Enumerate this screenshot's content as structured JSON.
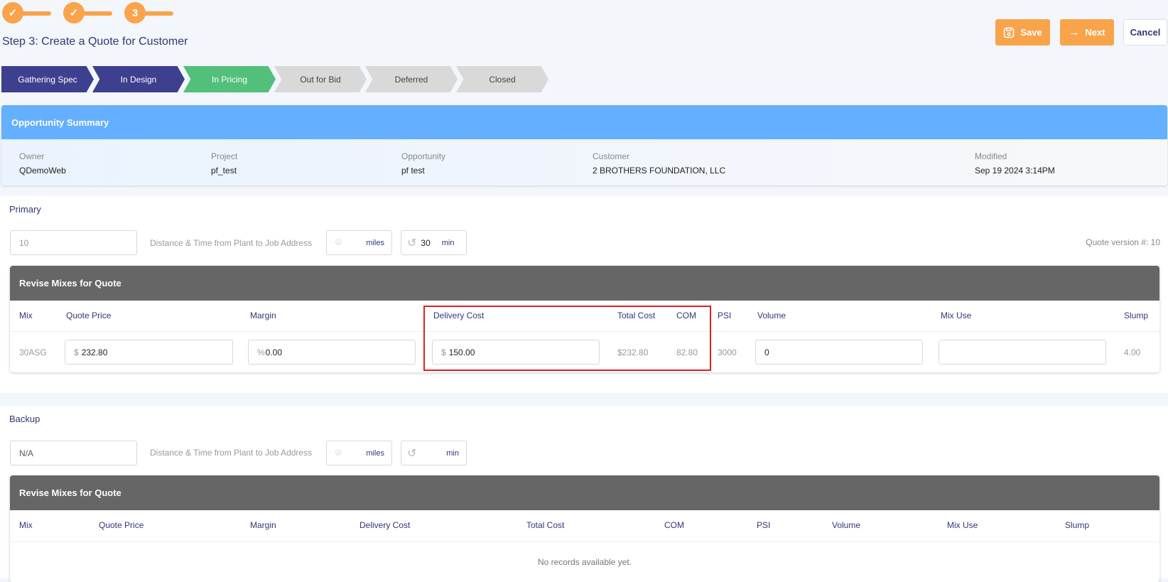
{
  "wizard": {
    "steps": [
      {
        "state": "done"
      },
      {
        "state": "done"
      },
      {
        "label": "3",
        "state": "current"
      }
    ],
    "title": "Step 3: Create a Quote for Customer"
  },
  "actions": {
    "save": "Save",
    "next": "Next",
    "cancel": "Cancel"
  },
  "stages": [
    {
      "label": "Gathering Spec",
      "state": "done"
    },
    {
      "label": "In Design",
      "state": "done"
    },
    {
      "label": "In Pricing",
      "state": "current"
    },
    {
      "label": "Out for Bid",
      "state": "pending"
    },
    {
      "label": "Deferred",
      "state": "pending"
    },
    {
      "label": "Closed",
      "state": "pending"
    }
  ],
  "summary": {
    "title": "Opportunity Summary",
    "fields": [
      {
        "label": "Owner",
        "value": "QDemoWeb"
      },
      {
        "label": "Project",
        "value": "pf_test"
      },
      {
        "label": "Opportunity",
        "value": "pf test"
      },
      {
        "label": "Customer",
        "value": "2 BROTHERS FOUNDATION, LLC"
      },
      {
        "label": "Modified",
        "value": "Sep 19 2024 3:14PM"
      }
    ]
  },
  "primary": {
    "title": "Primary",
    "plant": "10",
    "distance_label": "Distance & Time from Plant to Job Address",
    "miles_value": "",
    "miles_unit": "miles",
    "time_value": "30",
    "time_unit": "min",
    "quote_version": "Quote version #: 10",
    "table": {
      "title": "Revise Mixes for Quote",
      "columns": [
        "Mix",
        "Quote Price",
        "Margin",
        "Delivery Cost",
        "Total Cost",
        "COM",
        "PSI",
        "Volume",
        "Mix Use",
        "Slump"
      ],
      "rows": [
        {
          "mix": "30ASG",
          "quote_price": "232.80",
          "quote_prefix": "$",
          "margin": "0.00",
          "margin_prefix": "%",
          "delivery_cost": "150.00",
          "delivery_prefix": "$",
          "total_cost": "$232.80",
          "com": "82.80",
          "psi": "3000",
          "volume": "0",
          "mix_use": "",
          "slump": "4.00"
        }
      ]
    }
  },
  "backup": {
    "title": "Backup",
    "plant": "N/A",
    "distance_label": "Distance & Time from Plant to Job Address",
    "miles_unit": "miles",
    "time_unit": "min",
    "table": {
      "title": "Revise Mixes for Quote",
      "columns": [
        "Mix",
        "Quote Price",
        "Margin",
        "Delivery Cost",
        "Total Cost",
        "COM",
        "PSI",
        "Volume",
        "Mix Use",
        "Slump"
      ],
      "empty": "No records available yet."
    }
  },
  "colors": {
    "accent": "#f9a34b",
    "navy": "#3d3f8f",
    "green": "#52bf7a",
    "summary": "#64afff",
    "highlight": "#e02020"
  }
}
